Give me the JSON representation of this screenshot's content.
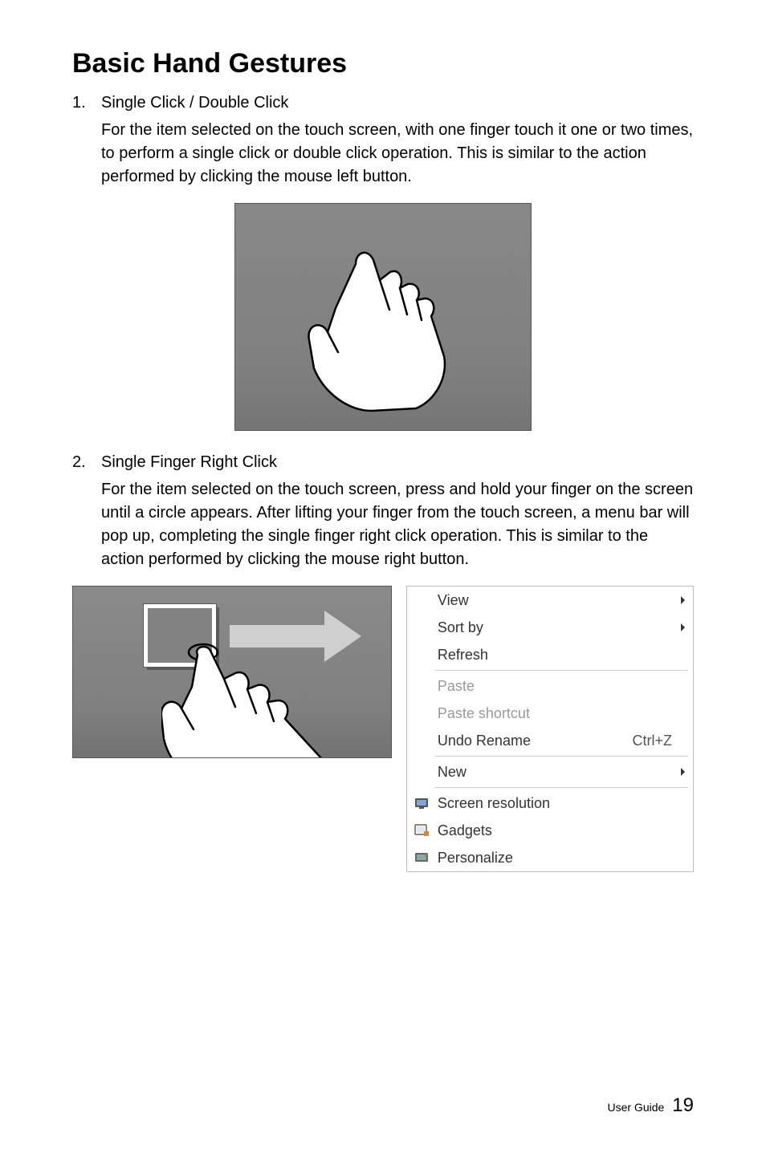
{
  "heading": "Basic Hand Gestures",
  "item1": {
    "num": "1.",
    "title": "Single Click / Double Click",
    "body": "For the item selected on the touch screen, with one finger touch it one or two times, to perform a single click or double click operation. This is similar to the action performed by clicking the mouse left button."
  },
  "item2": {
    "num": "2.",
    "title": "Single Finger Right Click",
    "body": "For the item selected on the touch screen, press and hold your finger on the screen until a circle appears. After lifting your finger from the touch screen, a menu bar will pop up, completing the single finger right click operation. This is similar to the action performed by clicking the mouse right button."
  },
  "ctx": {
    "view": "View",
    "sortby": "Sort by",
    "refresh": "Refresh",
    "paste": "Paste",
    "pasteshortcut": "Paste shortcut",
    "undorename": "Undo Rename",
    "undoshortcut": "Ctrl+Z",
    "new": "New",
    "screenres": "Screen resolution",
    "gadgets": "Gadgets",
    "personalize": "Personalize"
  },
  "footer": {
    "label": "User Guide",
    "page": "19"
  }
}
